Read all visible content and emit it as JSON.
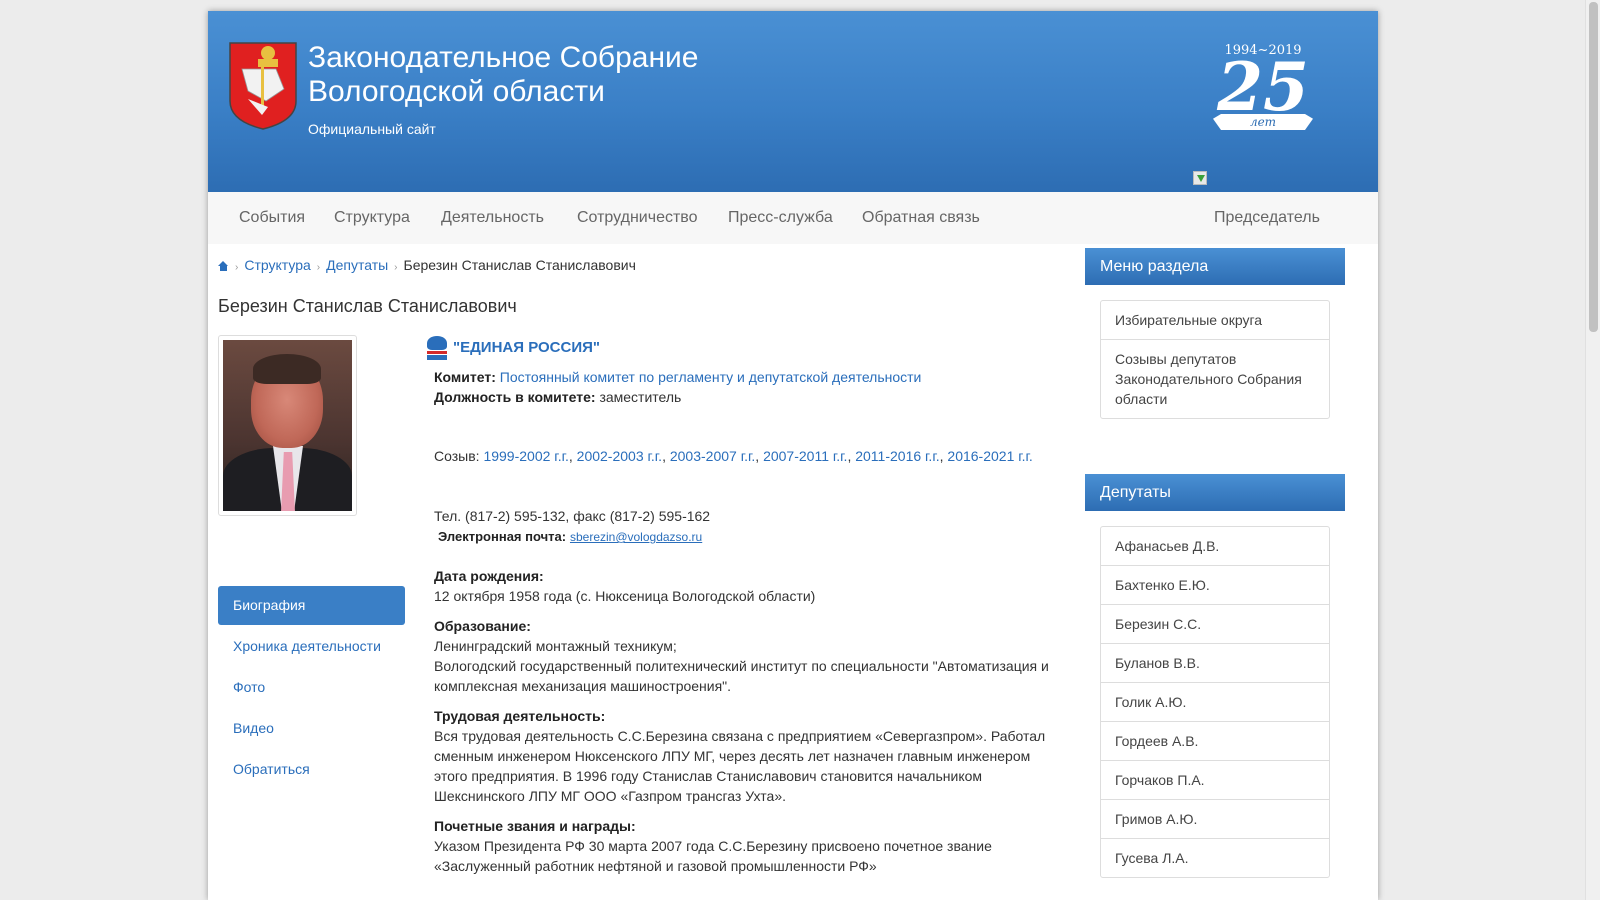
{
  "header": {
    "title_line1": "Законодательное Собрание",
    "title_line2": "Вологодской области",
    "subtitle": "Официальный сайт",
    "anniversary": {
      "years": "1994~2019",
      "number": "25",
      "word": "лет"
    }
  },
  "nav": {
    "items": [
      "События",
      "Структура",
      "Деятельность",
      "Сотрудничество",
      "Пресс-служба",
      "Обратная связь"
    ],
    "right_item": "Председатель"
  },
  "breadcrumb": {
    "items": [
      "Структура",
      "Депутаты"
    ],
    "current": "Березин Станислав Станиславович"
  },
  "person": {
    "name": "Березин Станислав Станиславович",
    "party": "\"ЕДИНАЯ РОССИЯ\"",
    "committee_label": "Комитет:",
    "committee": "Постоянный комитет по регламенту и депутатской деятельности",
    "position_label": "Должность в комитете:",
    "position": "заместитель",
    "convocations_label": "Созыв:",
    "convocations": [
      "1999-2002 г.г.",
      "2002-2003 г.г.",
      "2003-2007 г.г.",
      "2007-2011 г.г.",
      "2011-2016 г.г.",
      "2016-2021 г.г."
    ],
    "phone": "Тел. (817-2) 595-132, факс (817-2) 595-162",
    "email_label": "Электронная почта:",
    "email": "sberezin@vologdazso.ru"
  },
  "bio": {
    "birth_title": "Дата рождения:",
    "birth_text": "12 октября 1958 года (с. Нюксеница Вологодской области)",
    "education_title": "Образование:",
    "education_line1": "Ленинградский монтажный техникум;",
    "education_line2": "Вологодский государственный политехнический институт по специальности \"Автоматизация и комплексная механизация машиностроения\".",
    "work_title": "Трудовая деятельность:",
    "work_text": "Вся трудовая деятельность С.С.Березина связана с предприятием «Севергазпром». Работал сменным инженером Нюксенского ЛПУ МГ, через десять лет назначен главным инженером этого предприятия. В 1996 году Станислав Станиславович становится начальником Шекснинского ЛПУ МГ ООО «Газпром трансгаз Ухта».",
    "awards_title": "Почетные звания и награды:",
    "awards_text": "Указом Президента РФ 30 марта 2007 года С.С.Березину присвоено почетное звание «Заслуженный работник нефтяной и газовой промышленности РФ»"
  },
  "left_menu": [
    "Биография",
    "Хроника деятельности",
    "Фото",
    "Видео",
    "Обратиться"
  ],
  "sidebar": {
    "section_menu_title": "Меню раздела",
    "section_menu": [
      "Избирательные округа",
      "Созывы депутатов Законодательного Собрания области"
    ],
    "deputies_title": "Депутаты",
    "deputies": [
      "Афанасьев Д.В.",
      "Бахтенко Е.Ю.",
      "Березин С.С.",
      "Буланов В.В.",
      "Голик А.Ю.",
      "Гордеев А.В.",
      "Горчаков П.А.",
      "Гримов А.Ю.",
      "Гусева Л.А."
    ]
  },
  "colors": {
    "brand_blue": "#3a7fc6",
    "link_blue": "#2a6ebb",
    "crest_red": "#e02020",
    "crest_gold": "#e8c040"
  }
}
